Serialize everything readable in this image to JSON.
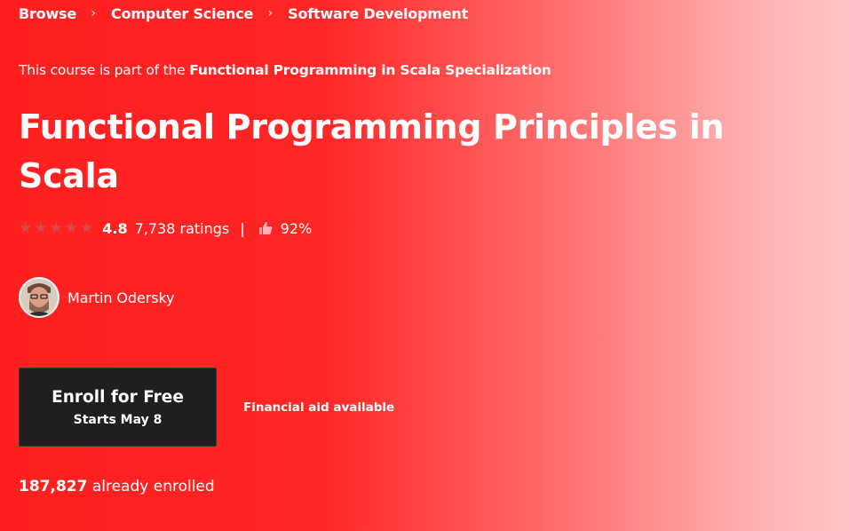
{
  "breadcrumb": [
    {
      "label": "Browse"
    },
    {
      "label": "Computer Science"
    },
    {
      "label": "Software Development"
    }
  ],
  "specialization": {
    "prefix": "This course is part of the ",
    "link": "Functional Programming in Scala Specialization"
  },
  "course": {
    "title": "Functional Programming Principles in Scala"
  },
  "rating": {
    "stars_count": 5,
    "stars_display": "★★★★★",
    "value": "4.8",
    "count": "7,738 ratings",
    "divider": "|",
    "like_percent": "92%",
    "like_icon": "thumbs-up-icon"
  },
  "instructor": {
    "name": "Martin Odersky"
  },
  "enroll": {
    "label": "Enroll for Free",
    "sub": "Starts May 8"
  },
  "financial_aid": "Financial aid available",
  "enrolled": {
    "count": "187,827",
    "suffix": " already enrolled"
  },
  "colors": {
    "gradient_start": "#ff1f1f",
    "gradient_end": "#ffc4c4",
    "button_bg": "#1f1f1f",
    "text": "#ffffff"
  }
}
